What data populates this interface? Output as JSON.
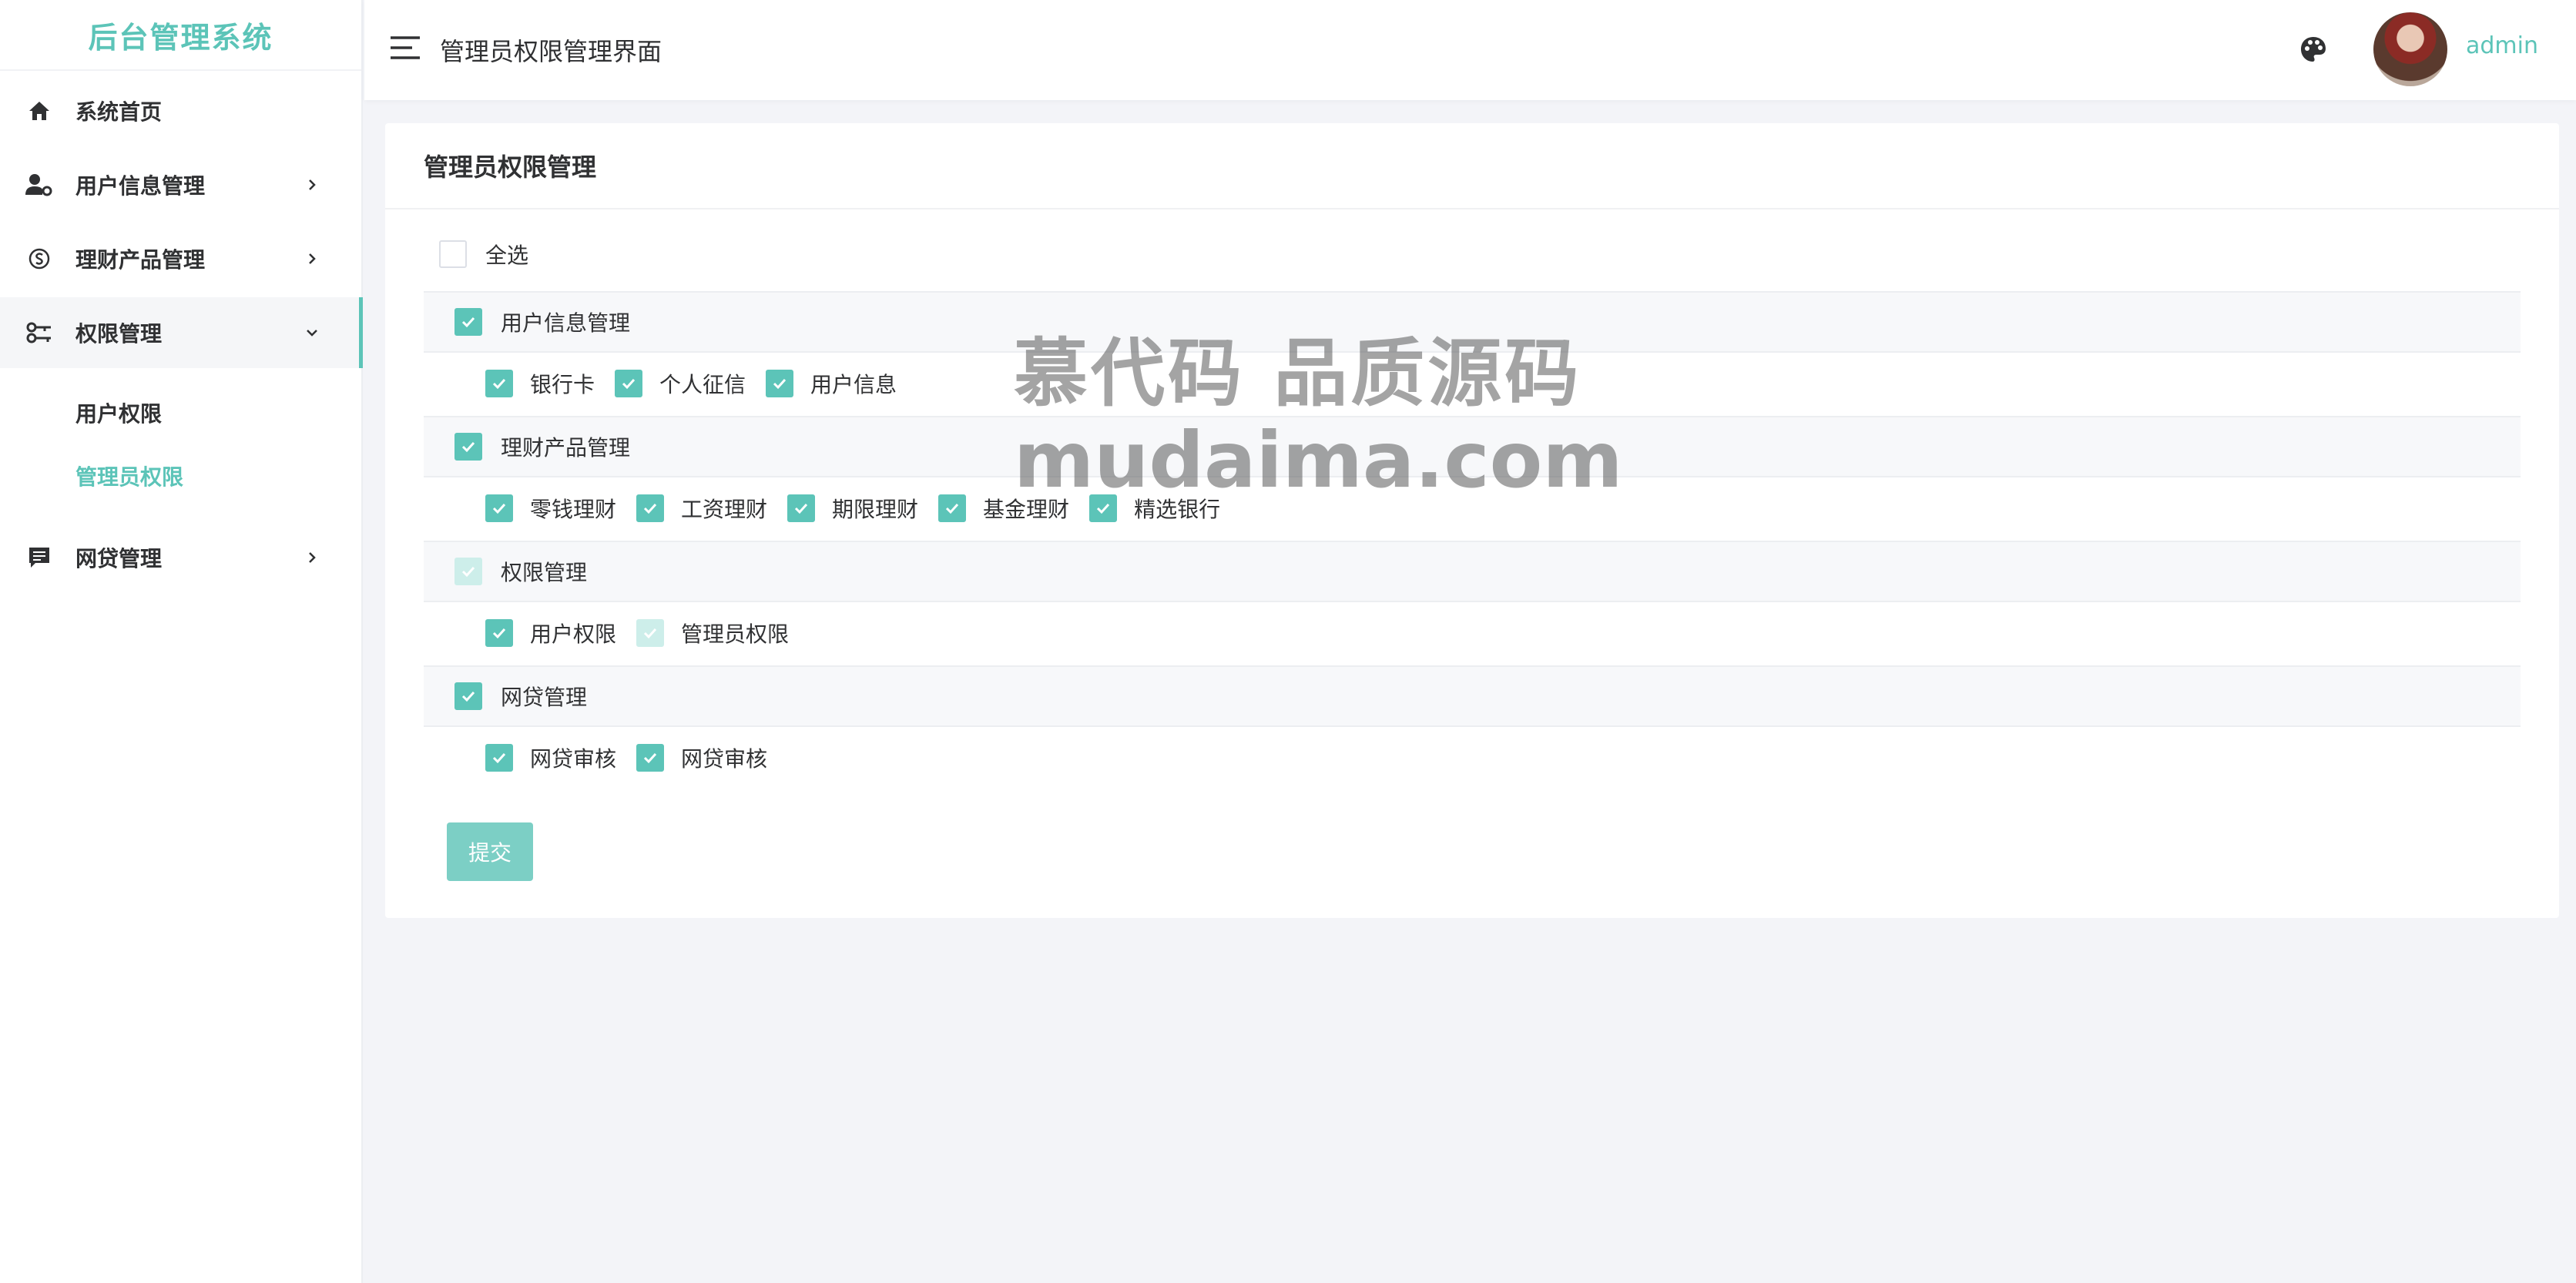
{
  "brand": "后台管理系统",
  "sidebar": {
    "items": [
      {
        "label": "系统首页",
        "icon": "home-icon"
      },
      {
        "label": "用户信息管理",
        "icon": "user-settings-icon"
      },
      {
        "label": "理财产品管理",
        "icon": "finance-icon"
      },
      {
        "label": "权限管理",
        "icon": "key-icon",
        "expanded": true
      },
      {
        "label": "网贷管理",
        "icon": "message-icon"
      }
    ],
    "sub_items": [
      {
        "label": "用户权限"
      },
      {
        "label": "管理员权限",
        "active": true
      }
    ]
  },
  "header": {
    "title": "管理员权限管理界面",
    "username": "admin"
  },
  "card": {
    "title": "管理员权限管理",
    "select_all": {
      "label": "全选",
      "checked": false
    },
    "groups": [
      {
        "label": "用户信息管理",
        "state": "checked",
        "children": [
          {
            "label": "银行卡",
            "state": "checked"
          },
          {
            "label": "个人征信",
            "state": "checked"
          },
          {
            "label": "用户信息",
            "state": "checked"
          }
        ]
      },
      {
        "label": "理财产品管理",
        "state": "checked",
        "children": [
          {
            "label": "零钱理财",
            "state": "checked"
          },
          {
            "label": "工资理财",
            "state": "checked"
          },
          {
            "label": "期限理财",
            "state": "checked"
          },
          {
            "label": "基金理财",
            "state": "checked"
          },
          {
            "label": "精选银行",
            "state": "checked"
          }
        ]
      },
      {
        "label": "权限管理",
        "state": "disabled",
        "children": [
          {
            "label": "用户权限",
            "state": "checked"
          },
          {
            "label": "管理员权限",
            "state": "disabled"
          }
        ]
      },
      {
        "label": "网贷管理",
        "state": "checked",
        "children": [
          {
            "label": "网贷审核",
            "state": "checked"
          },
          {
            "label": "网贷审核",
            "state": "checked"
          }
        ]
      }
    ],
    "submit_label": "提交"
  },
  "watermark": {
    "line1": "慕代码 品质源码",
    "line2": "mudaima.com"
  },
  "colors": {
    "accent": "#5cc4b8",
    "background": "#f3f4f8"
  }
}
